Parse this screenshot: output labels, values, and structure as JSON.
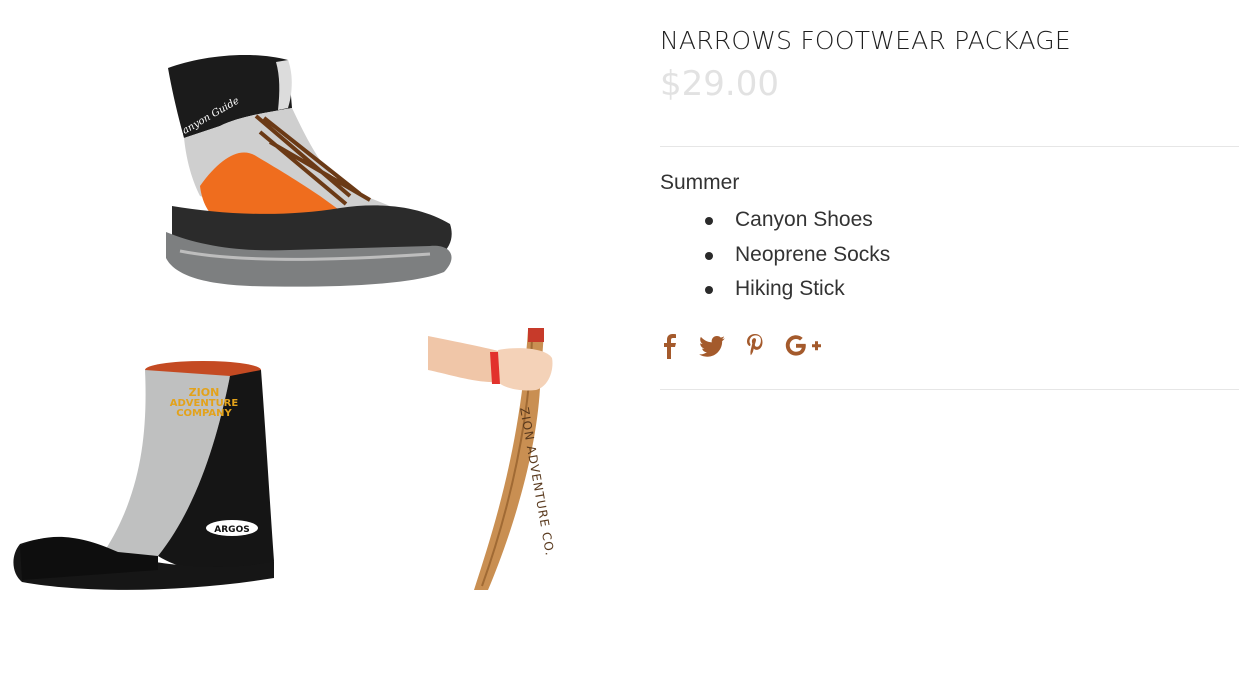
{
  "product": {
    "title": "NARROWS FOOTWEAR PACKAGE",
    "price": "$29.00",
    "season": "Summer",
    "items": [
      "Canyon Shoes",
      "Neoprene Socks",
      "Hiking Stick"
    ]
  },
  "images": {
    "boot": {
      "alt": "canyon boot",
      "brand_text": "Canyon Guide"
    },
    "sock": {
      "alt": "neoprene sock",
      "brand_text": [
        "ZION",
        "ADVENTURE",
        "COMPANY"
      ],
      "logo_text": "ARGOS"
    },
    "stick": {
      "alt": "hiking stick",
      "engraving": "ZION ADVENTURE CO."
    }
  },
  "social": [
    {
      "name": "facebook-icon"
    },
    {
      "name": "twitter-icon"
    },
    {
      "name": "pinterest-icon"
    },
    {
      "name": "google-plus-icon"
    }
  ],
  "colors": {
    "accent": "#a45a2c",
    "price": "#e2e2e2",
    "boot_orange": "#ef6d1e"
  }
}
